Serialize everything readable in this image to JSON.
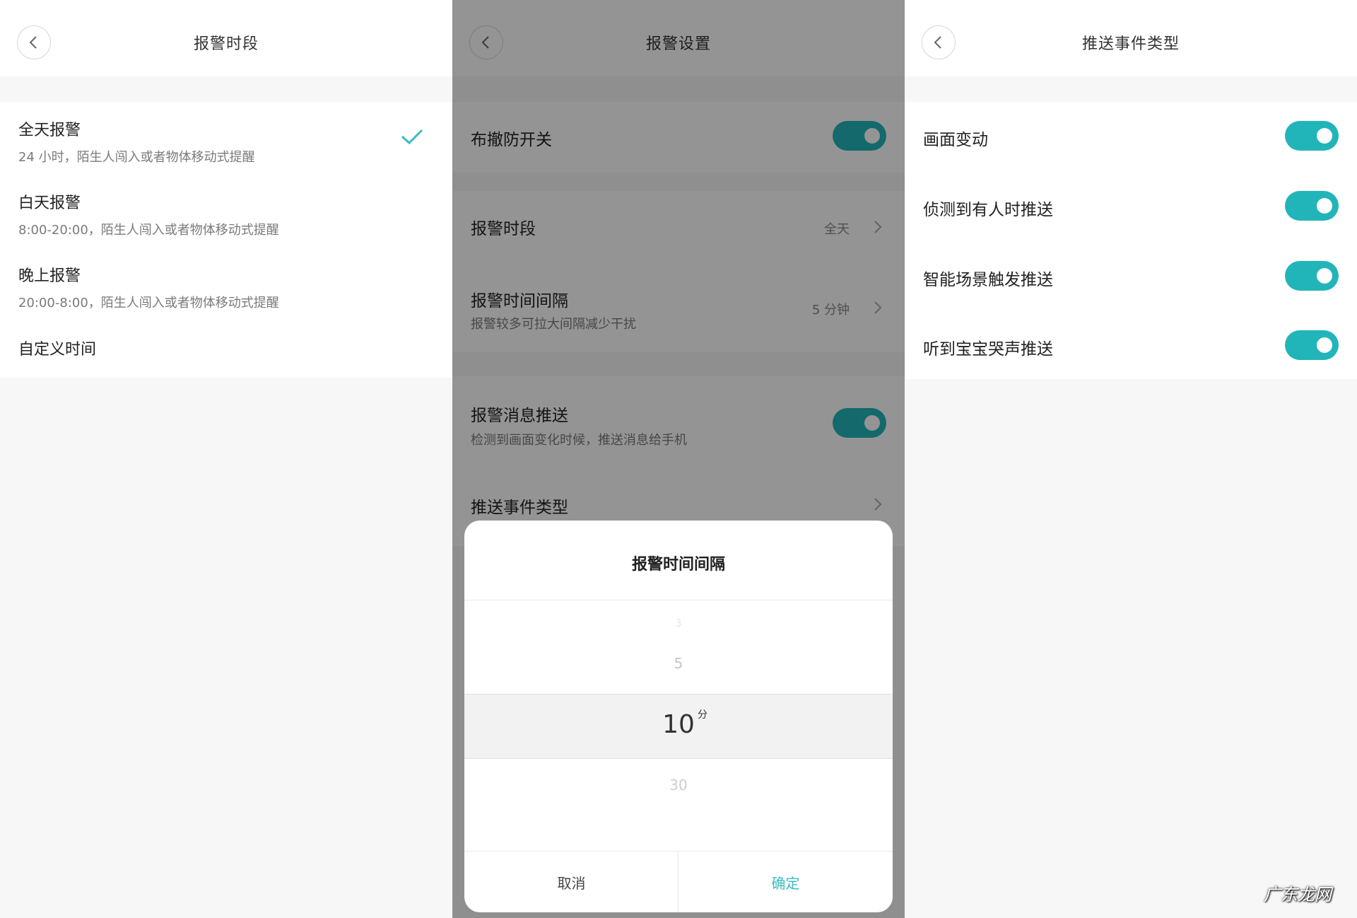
{
  "panel1": {
    "title": "报警时段",
    "options": [
      {
        "title": "全天报警",
        "subtitle": "24 小时，陌生人闯入或者物体移动式提醒",
        "selected": true
      },
      {
        "title": "白天报警",
        "subtitle": "8:00-20:00，陌生人闯入或者物体移动式提醒"
      },
      {
        "title": "晚上报警",
        "subtitle": "20:00-8:00，陌生人闯入或者物体移动式提醒"
      },
      {
        "title": "自定义时间"
      }
    ],
    "check_icon": "check-icon",
    "accent": "#3bbcc1"
  },
  "panel2": {
    "title": "报警设置",
    "rows": {
      "arm": {
        "title": "布撤防开关",
        "on": true
      },
      "period": {
        "title": "报警时段",
        "value": "全天"
      },
      "interval": {
        "title": "报警时间间隔",
        "subtitle": "报警较多可拉大间隔减少干扰",
        "value": "5 分钟"
      },
      "push": {
        "title": "报警消息推送",
        "subtitle": "检测到画面变化时候，推送消息给手机",
        "on": true
      },
      "event_type": {
        "title": "推送事件类型"
      }
    },
    "dialog": {
      "title": "报警时间间隔",
      "picker_faded_top": "3",
      "picker_above": "5",
      "picker_selected": "10",
      "picker_unit": "分",
      "picker_below": "30",
      "cancel": "取消",
      "confirm": "确定",
      "confirm_color": "#3bbcc1"
    }
  },
  "panel3": {
    "title": "推送事件类型",
    "items": [
      {
        "title": "画面变动",
        "on": true
      },
      {
        "title": "侦测到有人时推送",
        "on": true
      },
      {
        "title": "智能场景触发推送",
        "on": true
      },
      {
        "title": "听到宝宝哭声推送",
        "on": true
      }
    ],
    "toggle_color": "#21b5b9"
  },
  "watermark": "广东龙网"
}
